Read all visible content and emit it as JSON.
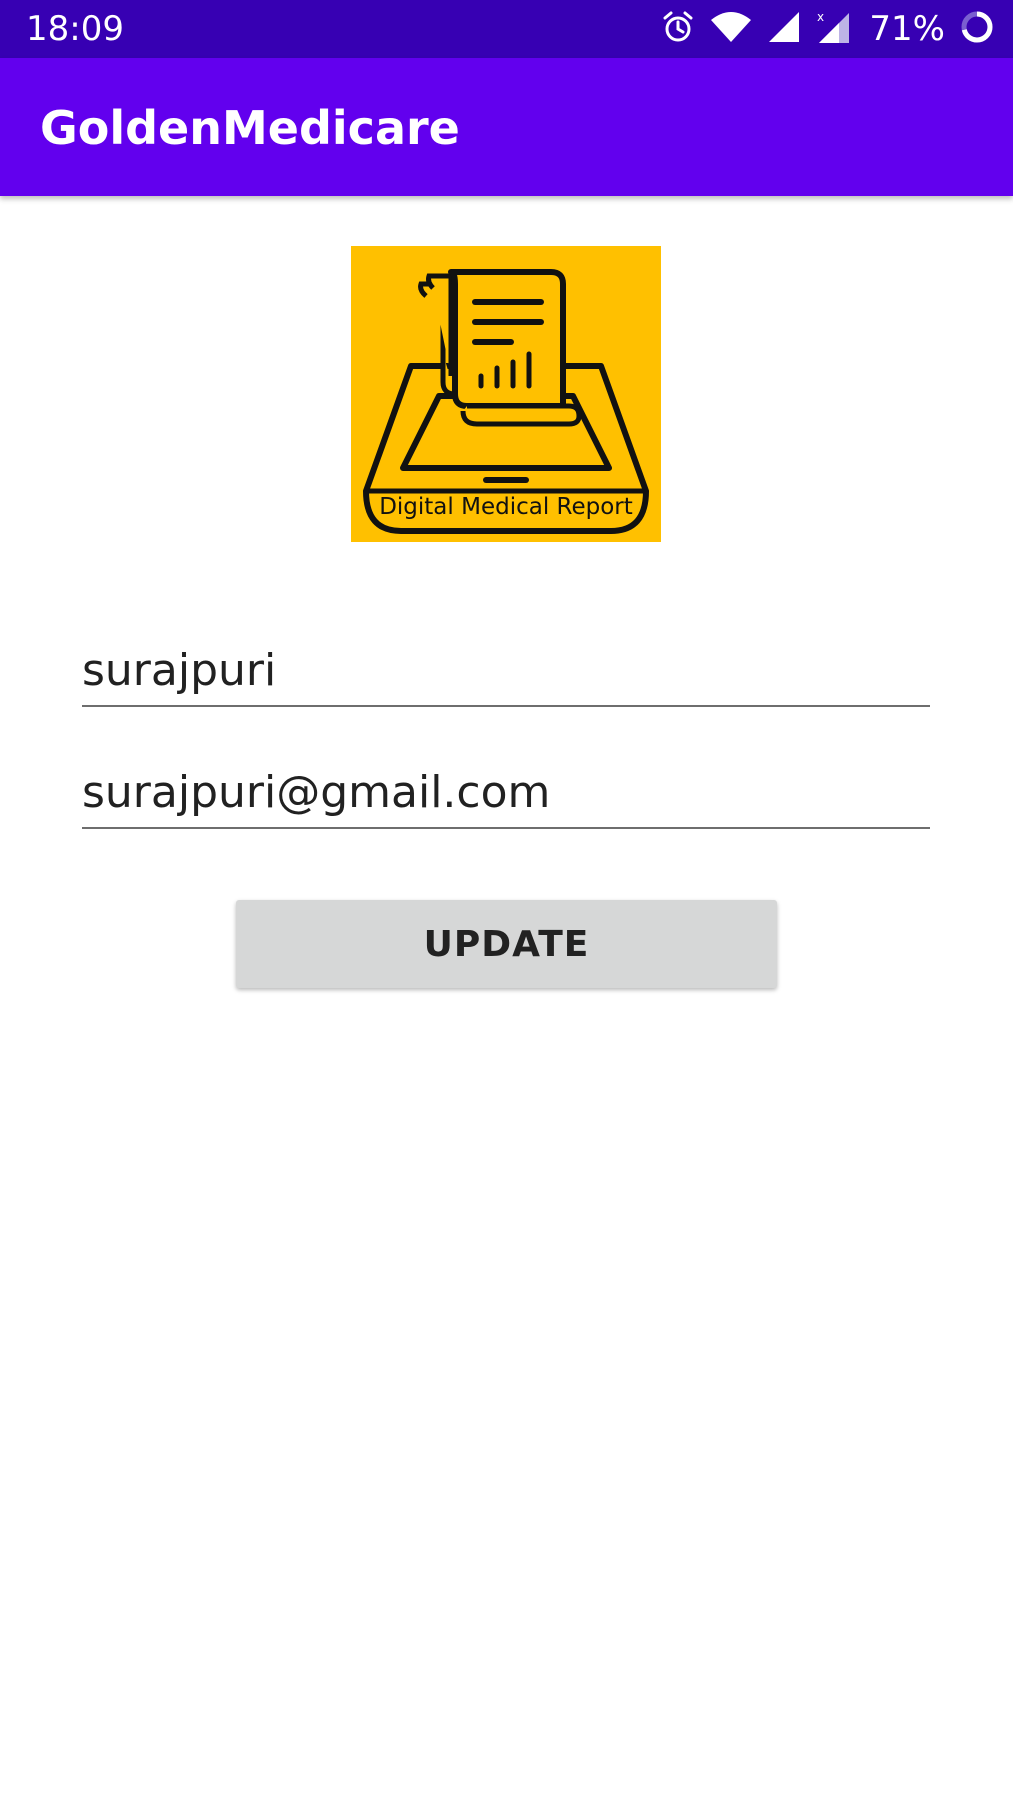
{
  "status_bar": {
    "time": "18:09",
    "battery_percent": "71%",
    "icons": [
      "alarm-icon",
      "wifi-icon",
      "signal-icon",
      "signal-no-data-icon",
      "battery-ring-icon"
    ]
  },
  "app_bar": {
    "title": "GoldenMedicare",
    "color": "#6200ee"
  },
  "logo": {
    "caption": "Digital Medical Report",
    "background": "#ffc000"
  },
  "form": {
    "name_value": "surajpuri",
    "email_value": "surajpuri@gmail.com",
    "update_label": "UPDATE"
  },
  "colors": {
    "status_bar": "#3700b3",
    "primary": "#6200ee",
    "button": "#d6d7d7"
  }
}
